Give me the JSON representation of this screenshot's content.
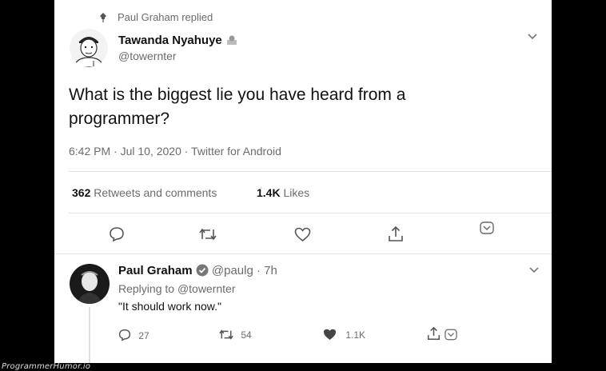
{
  "context": {
    "replied_label": "Paul Graham replied"
  },
  "tweet": {
    "author_name": "Tawanda Nyahuye",
    "author_handle": "@towernter",
    "text_line1": "What is the biggest lie you have heard from a",
    "text_line2": "programmer?",
    "meta": "6:42 PM · Jul 10, 2020 · Twitter for Android",
    "retweets_count": "362",
    "retweets_label": "Retweets and comments",
    "likes_count": "1.4K",
    "likes_label": "Likes"
  },
  "reply": {
    "author_name": "Paul Graham",
    "author_handle": "@paulg",
    "time": "· 7h",
    "replying_to_prefix": "Replying to",
    "replying_to_handle": "@towernter",
    "text": "\"It should work now.\"",
    "reply_count": "27",
    "retweet_count": "54",
    "like_count": "1.1K"
  },
  "watermark": "ProgrammerHumor.io",
  "icons": [
    "pin-icon",
    "chevron-down-icon",
    "comment-icon",
    "retweet-icon",
    "heart-icon",
    "share-icon",
    "verified-badge-icon"
  ]
}
